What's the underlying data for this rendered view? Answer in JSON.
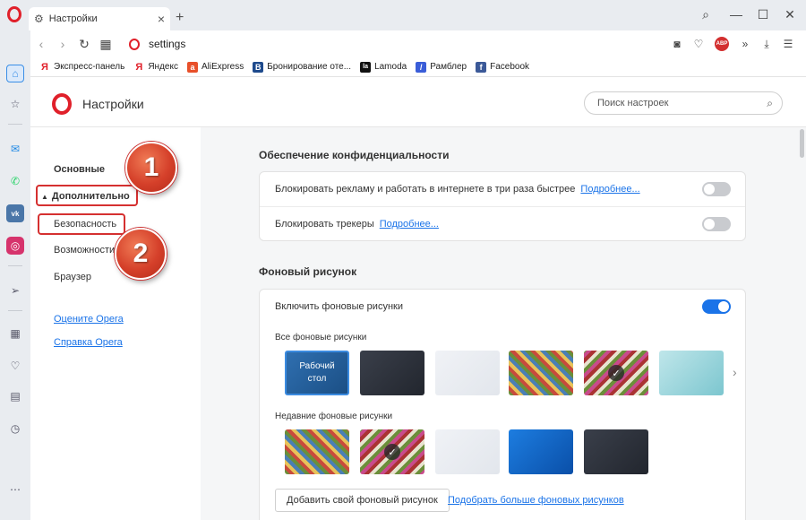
{
  "window": {
    "tab_title": "Настройки",
    "new_tab": "+",
    "minimize": "—",
    "maximize": "☐",
    "close": "✕",
    "search": "⌕"
  },
  "address_bar": {
    "url": "settings",
    "abp": "ABP"
  },
  "bookmarks": [
    {
      "label": "Экспресс-панель",
      "icon": "yandex-icon",
      "color": "#e0202a",
      "glyph": "Я"
    },
    {
      "label": "Яндекс",
      "icon": "yandex-icon",
      "color": "#e0202a",
      "glyph": "Я"
    },
    {
      "label": "AliExpress",
      "icon": "aliexpress-icon",
      "color": "#e8502a",
      "glyph": "a"
    },
    {
      "label": "Бронирование оте...",
      "icon": "booking-icon",
      "color": "#1e4a8c",
      "glyph": "B"
    },
    {
      "label": "Lamoda",
      "icon": "lamoda-icon",
      "color": "#111111",
      "glyph": "la"
    },
    {
      "label": "Рамблер",
      "icon": "rambler-icon",
      "color": "#3a5dd8",
      "glyph": "/"
    },
    {
      "label": "Facebook",
      "icon": "facebook-icon",
      "color": "#3b5998",
      "glyph": "f"
    }
  ],
  "settings": {
    "title": "Настройки",
    "search_placeholder": "Поиск настроек"
  },
  "nav": {
    "basic": "Основные",
    "advanced": "Дополнительно",
    "security": "Безопасность",
    "features": "Возможности",
    "browser": "Браузер",
    "rate_opera": "Оцените Opera",
    "help_opera": "Справка Opera"
  },
  "annotations": {
    "badge1": "1",
    "badge2": "2"
  },
  "privacy": {
    "title": "Обеспечение конфиденциальности",
    "rows": [
      {
        "label": "Блокировать рекламу и работать в интернете в три раза быстрее",
        "link": "Подробнее...",
        "enabled": false
      },
      {
        "label": "Блокировать трекеры",
        "link": "Подробнее...",
        "enabled": false
      }
    ]
  },
  "wallpapers": {
    "title": "Фоновый рисунок",
    "enable_label": "Включить фоновые рисунки",
    "enabled": true,
    "all_label": "Все фоновые рисунки",
    "recent_label": "Недавние фоновые рисунки",
    "desktop_label": "Рабочий стол",
    "add_button": "Добавить свой фоновый рисунок",
    "more_link": "Подобрать больше фоновых рисунков",
    "check": "✓"
  },
  "colors": {
    "accent": "#1a73e8",
    "brand_red": "#e0202a",
    "highlight_red": "#d53030"
  }
}
